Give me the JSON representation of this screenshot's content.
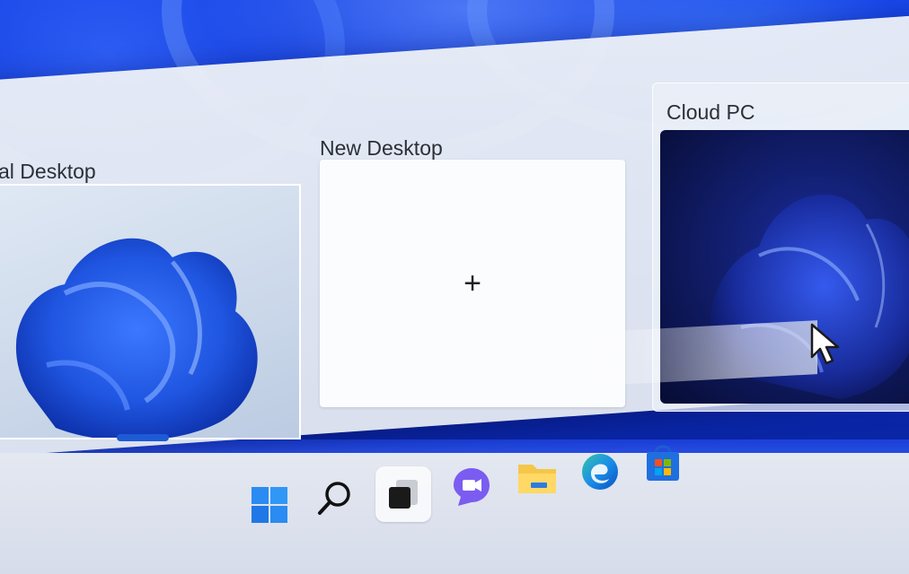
{
  "desktops": [
    {
      "title": "al Desktop",
      "active": true
    },
    {
      "title": "New Desktop",
      "add_symbol": "+"
    },
    {
      "title": "Cloud PC"
    }
  ],
  "taskbar": {
    "icons": [
      {
        "name": "start-icon"
      },
      {
        "name": "search-icon"
      },
      {
        "name": "task-view-icon",
        "active": true
      },
      {
        "name": "teams-chat-icon"
      },
      {
        "name": "file-explorer-icon"
      },
      {
        "name": "edge-icon"
      },
      {
        "name": "store-icon"
      }
    ]
  },
  "colors": {
    "accent": "#1e5ad6",
    "wallpaper": "#0b2fc4",
    "panel": "#e7ebf3",
    "cloud_card": "#101c66"
  }
}
